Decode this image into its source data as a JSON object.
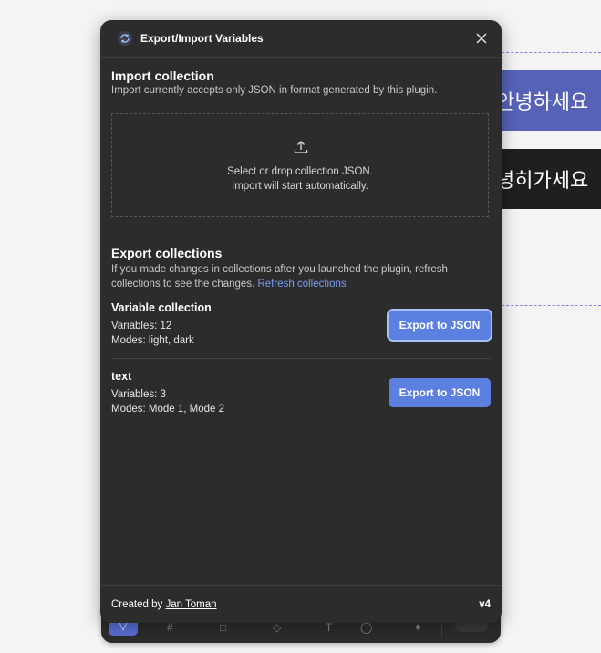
{
  "canvas": {
    "frame1_text": "안녕하세요",
    "frame2_text": "녕히가세요"
  },
  "dialog": {
    "title": "Export/Import Variables",
    "close_icon": "close-icon",
    "import": {
      "title": "Import collection",
      "description": "Import currently accepts only JSON in format generated by this plugin.",
      "dropzone_line1": "Select or drop collection JSON.",
      "dropzone_line2": "Import will start automatically.",
      "icon": "upload-icon"
    },
    "export": {
      "title": "Export collections",
      "description": "If you made changes in collections after you launched the plugin, refresh collections to see the changes.",
      "refresh_label": "Refresh collections",
      "collections": [
        {
          "name": "Variable collection",
          "variables": "Variables: 12",
          "modes": "Modes: light, dark",
          "button": "Export to JSON"
        },
        {
          "name": "text",
          "variables": "Variables: 3",
          "modes": "Modes: Mode 1, Mode 2",
          "button": "Export to JSON"
        }
      ]
    },
    "footer": {
      "created_by": "Created by",
      "author": "Jan Toman",
      "version": "v4"
    }
  },
  "colors": {
    "dialog_bg": "#2c2c2c",
    "accent": "#5b80e0",
    "link": "#7b9cf5"
  }
}
